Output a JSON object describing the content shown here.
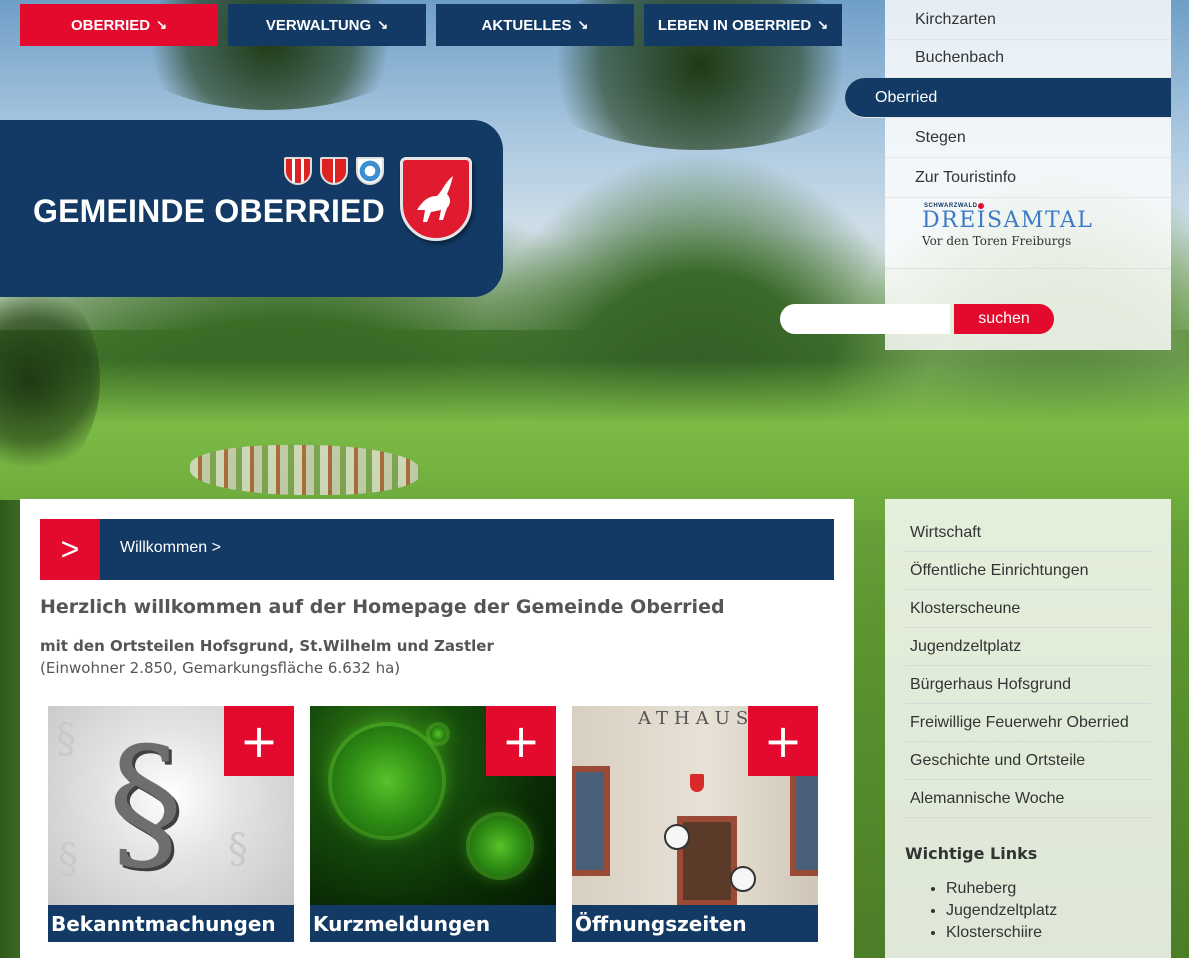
{
  "nav": [
    {
      "label": "OBERRIED",
      "arrow": "↘"
    },
    {
      "label": "VERWALTUNG",
      "arrow": "↘"
    },
    {
      "label": "AKTUELLES",
      "arrow": "↘"
    },
    {
      "label": "LEBEN IN OBERRIED",
      "arrow": "↘"
    }
  ],
  "header": {
    "title": "GEMEINDE OBERRIED"
  },
  "right_menu": {
    "items": [
      {
        "label": "Kirchzarten"
      },
      {
        "label": "Buchenbach"
      },
      {
        "label": "Oberried"
      },
      {
        "label": "Stegen"
      },
      {
        "label": "Zur Touristinfo"
      }
    ],
    "logo": {
      "small": "SCHWARZWALD",
      "big": "DREISAMTAL",
      "sub": "Vor den Toren Freiburgs"
    }
  },
  "search": {
    "placeholder": "",
    "button_label": "suchen"
  },
  "welcome": {
    "arrow": ">",
    "bar_label": "Willkommen >",
    "headline": "Herzlich willkommen auf der Homepage der Gemeinde Oberried",
    "subline1": "mit den Ortsteilen Hofsgrund, St.Wilhelm und Zastler",
    "subline2": "(Einwohner 2.850, Gemarkungsfläche 6.632 ha)"
  },
  "tiles": [
    {
      "label": "Bekanntmachungen",
      "plus": "+",
      "symbol": "§"
    },
    {
      "label": "Kurzmeldungen",
      "plus": "+"
    },
    {
      "label": "Öffnungszeiten",
      "plus": "+",
      "sign": "ATHAUS"
    }
  ],
  "side_menu": {
    "items": [
      {
        "label": "Wirtschaft"
      },
      {
        "label": "Öffentliche Einrichtungen"
      },
      {
        "label": "Klosterscheune"
      },
      {
        "label": "Jugendzeltplatz"
      },
      {
        "label": "Bürgerhaus Hofsgrund"
      },
      {
        "label": "Freiwillige Feuerwehr Oberried"
      },
      {
        "label": "Geschichte und Ortsteile"
      },
      {
        "label": "Alemannische Woche"
      }
    ],
    "links_title": "Wichtige Links",
    "links": [
      "Ruheberg",
      "Jugendzeltplatz",
      "Klosterschiire"
    ]
  },
  "colors": {
    "brand_blue": "#123a64",
    "brand_red": "#e30a2e"
  }
}
